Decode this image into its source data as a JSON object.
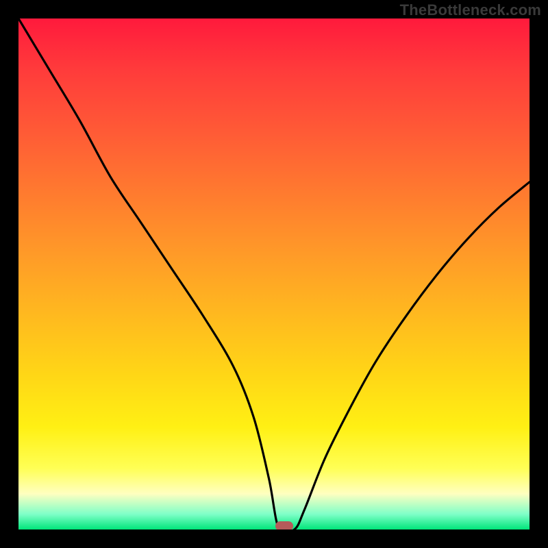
{
  "attribution": "TheBottleneck.com",
  "chart_data": {
    "type": "line",
    "title": "",
    "xlabel": "",
    "ylabel": "",
    "xlim": [
      0,
      100
    ],
    "ylim": [
      0,
      100
    ],
    "x": [
      0,
      6,
      12,
      18,
      24,
      30,
      36,
      42,
      46,
      49,
      51,
      54,
      56,
      60,
      65,
      70,
      76,
      82,
      88,
      94,
      100
    ],
    "values": [
      100,
      90,
      80,
      69,
      60,
      51,
      42,
      32,
      22,
      10,
      0,
      0,
      4,
      14,
      24,
      33,
      42,
      50,
      57,
      63,
      68
    ],
    "marker_x": 52,
    "marker_y": 0,
    "gradient_stops": [
      {
        "pos": 0.0,
        "color": "#ff1a3c"
      },
      {
        "pos": 0.1,
        "color": "#ff3b3b"
      },
      {
        "pos": 0.22,
        "color": "#ff5a36"
      },
      {
        "pos": 0.34,
        "color": "#ff7a2f"
      },
      {
        "pos": 0.46,
        "color": "#ff9a28"
      },
      {
        "pos": 0.58,
        "color": "#ffb91f"
      },
      {
        "pos": 0.7,
        "color": "#ffd716"
      },
      {
        "pos": 0.8,
        "color": "#fff014"
      },
      {
        "pos": 0.88,
        "color": "#ffff55"
      },
      {
        "pos": 0.93,
        "color": "#ffffc0"
      },
      {
        "pos": 0.97,
        "color": "#7fffc8"
      },
      {
        "pos": 1.0,
        "color": "#00e67a"
      }
    ]
  }
}
